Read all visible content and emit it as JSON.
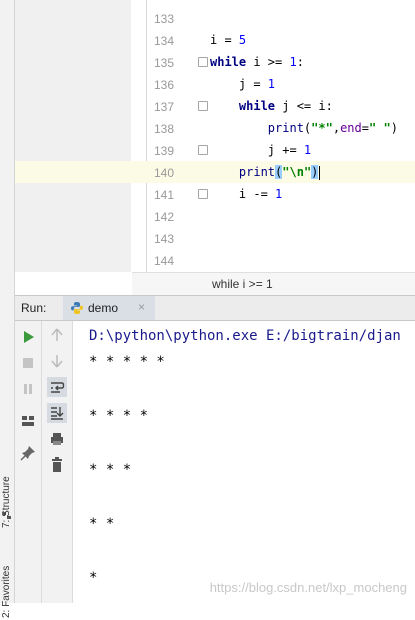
{
  "left_strip": {
    "structure_label": "7: Structure",
    "favorites_label": "2: Favorites"
  },
  "editor": {
    "lines": [
      {
        "num": "133"
      },
      {
        "num": "134",
        "text": "i = 5"
      },
      {
        "num": "135",
        "text": "while i >= 1:"
      },
      {
        "num": "136",
        "text": "    j = 1"
      },
      {
        "num": "137",
        "text": "    while j <= i:"
      },
      {
        "num": "138",
        "text": "        print(\"*\",end=\" \")"
      },
      {
        "num": "139",
        "text": "        j += 1"
      },
      {
        "num": "140",
        "text": "    print(\"\\n\")"
      },
      {
        "num": "141",
        "text": "    i -= 1"
      },
      {
        "num": "142"
      },
      {
        "num": "143"
      },
      {
        "num": "144"
      }
    ],
    "current_line": "140",
    "breadcrumb": "while i >= 1"
  },
  "run": {
    "label": "Run:",
    "tab_name": "demo",
    "console_lines": [
      "D:\\python\\python.exe E:/bigtrain/djan",
      "* * * * *",
      "",
      "* * * *",
      "",
      "* * *",
      "",
      "* *",
      "",
      "*"
    ]
  },
  "watermark": "https://blog.csdn.net/lxp_mocheng",
  "colors": {
    "keyword": "#000080",
    "number": "#0000ff",
    "string": "#008000",
    "kwarg": "#660099",
    "current_line_bg": "#fcfbe6",
    "run_green": "#3c9a3c"
  }
}
